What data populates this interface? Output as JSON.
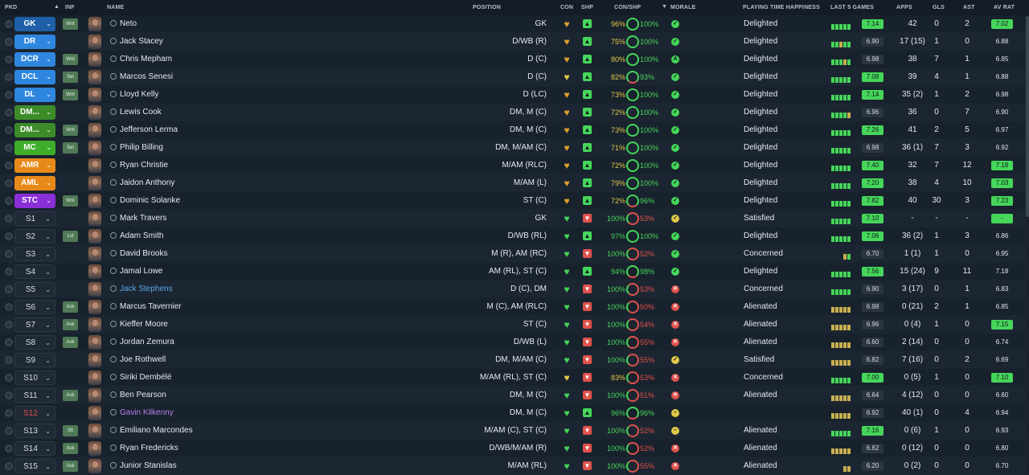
{
  "columns": {
    "pkd": "PKD",
    "inf": "INF",
    "name": "NAME",
    "position": "POSITION",
    "con": "CON",
    "shp": "SHP",
    "con_shp": "CON/SHP",
    "morale": "MORALE",
    "ptime": "PLAYING TIME HAPPINESS",
    "last5": "LAST 5 GAMES",
    "apps": "APPS",
    "gls": "GLS",
    "ast": "AST",
    "avrat": "AV RAT"
  },
  "colors": {
    "gk": "#1f5fa8",
    "def": "#2e86de",
    "dm": "#3d8c2a",
    "mid": "#3fae2b",
    "att_mid": "#e88a1a",
    "striker": "#8a2fd8",
    "good": "#45d65a",
    "bad": "#e0524c",
    "warn": "#e0c94a",
    "gold": "#e0a02a"
  },
  "players": [
    {
      "pkd": "GK",
      "pkd_color": "gk",
      "inf": "Wnt",
      "name": "Neto",
      "name_style": "",
      "position": "GK",
      "con_icon": "heart-gold-icon",
      "con_color": "gold",
      "shp": "up",
      "con_pct": "96%",
      "con_pct_color": "warn",
      "ring": "full",
      "shp_pct": "100%",
      "shp_pct_color": "good",
      "morale": "check",
      "morale_color": "good",
      "ptime": "Delighted",
      "form": [
        "good",
        "good",
        "good",
        "good",
        "good"
      ],
      "last5": "7.14",
      "last5_hi": true,
      "apps": "42",
      "gls": "0",
      "ast": "2",
      "avrat": "7.02",
      "avrat_hi": true
    },
    {
      "pkd": "DR",
      "pkd_color": "def",
      "inf": "",
      "name": "Jack Stacey",
      "name_style": "",
      "position": "D/WB (R)",
      "con_icon": "heart-gold-icon",
      "con_color": "gold",
      "shp": "up",
      "con_pct": "75%",
      "con_pct_color": "warn",
      "ring": "full",
      "shp_pct": "100%",
      "shp_pct_color": "good",
      "morale": "check",
      "morale_color": "good",
      "ptime": "Delighted",
      "form": [
        "good",
        "good",
        "warn",
        "good",
        "good"
      ],
      "last5": "6.90",
      "last5_hi": false,
      "apps": "17 (15)",
      "gls": "1",
      "ast": "0",
      "avrat": "6.88",
      "avrat_hi": false
    },
    {
      "pkd": "DCR",
      "pkd_color": "def",
      "inf": "Wnt",
      "name": "Chris Mepham",
      "name_style": "",
      "position": "D (C)",
      "con_icon": "heart-gold-icon",
      "con_color": "gold",
      "shp": "up",
      "con_pct": "80%",
      "con_pct_color": "warn",
      "ring": "full",
      "shp_pct": "100%",
      "shp_pct_color": "good",
      "morale": "A",
      "morale_color": "good",
      "ptime": "Delighted",
      "form": [
        "good",
        "good",
        "good",
        "warn",
        "good"
      ],
      "last5": "6.98",
      "last5_hi": false,
      "apps": "38",
      "gls": "7",
      "ast": "1",
      "avrat": "6.85",
      "avrat_hi": false
    },
    {
      "pkd": "DCL",
      "pkd_color": "def",
      "inf": "Sel",
      "name": "Marcos Senesi",
      "name_style": "",
      "position": "D (C)",
      "con_icon": "heart-gold-icon",
      "con_color": "warn",
      "shp": "upup",
      "con_pct": "82%",
      "con_pct_color": "warn",
      "ring": "partial",
      "shp_pct": "93%",
      "shp_pct_color": "good",
      "morale": "check",
      "morale_color": "good",
      "ptime": "Delighted",
      "form": [
        "good",
        "good",
        "good",
        "good",
        "good"
      ],
      "last5": "7.08",
      "last5_hi": true,
      "apps": "39",
      "gls": "4",
      "ast": "1",
      "avrat": "6.88",
      "avrat_hi": false
    },
    {
      "pkd": "DL",
      "pkd_color": "def",
      "inf": "Wnt",
      "name": "Lloyd Kelly",
      "name_style": "",
      "position": "D (LC)",
      "con_icon": "heart-gold-icon",
      "con_color": "gold",
      "shp": "up",
      "con_pct": "73%",
      "con_pct_color": "warn",
      "ring": "full",
      "shp_pct": "100%",
      "shp_pct_color": "good",
      "morale": "check",
      "morale_color": "good",
      "ptime": "Delighted",
      "form": [
        "good",
        "good",
        "good",
        "good",
        "good"
      ],
      "last5": "7.14",
      "last5_hi": true,
      "apps": "35 (2)",
      "gls": "1",
      "ast": "2",
      "avrat": "6.98",
      "avrat_hi": false
    },
    {
      "pkd": "DM...",
      "pkd_color": "dm",
      "inf": "",
      "name": "Lewis Cook",
      "name_style": "",
      "position": "DM, M (C)",
      "con_icon": "heart-gold-icon",
      "con_color": "gold",
      "shp": "up",
      "con_pct": "72%",
      "con_pct_color": "warn",
      "ring": "full",
      "shp_pct": "100%",
      "shp_pct_color": "good",
      "morale": "check",
      "morale_color": "good",
      "ptime": "Delighted",
      "form": [
        "good",
        "good",
        "good",
        "good",
        "warn"
      ],
      "last5": "6.96",
      "last5_hi": false,
      "apps": "36",
      "gls": "0",
      "ast": "7",
      "avrat": "6.90",
      "avrat_hi": false
    },
    {
      "pkd": "DM...",
      "pkd_color": "dm",
      "inf": "Wnt",
      "name": "Jefferson Lerma",
      "name_style": "",
      "position": "DM, M (C)",
      "con_icon": "heart-gold-icon",
      "con_color": "gold",
      "shp": "up",
      "con_pct": "73%",
      "con_pct_color": "warn",
      "ring": "full",
      "shp_pct": "100%",
      "shp_pct_color": "good",
      "morale": "check",
      "morale_color": "good",
      "ptime": "Delighted",
      "form": [
        "good",
        "good",
        "good",
        "good",
        "good"
      ],
      "last5": "7.26",
      "last5_hi": true,
      "apps": "41",
      "gls": "2",
      "ast": "5",
      "avrat": "6.97",
      "avrat_hi": false
    },
    {
      "pkd": "MC",
      "pkd_color": "mid",
      "inf": "Sel",
      "name": "Philip Billing",
      "name_style": "",
      "position": "DM, M/AM (C)",
      "con_icon": "heart-gold-icon",
      "con_color": "gold",
      "shp": "up",
      "con_pct": "71%",
      "con_pct_color": "warn",
      "ring": "full",
      "shp_pct": "100%",
      "shp_pct_color": "good",
      "morale": "check",
      "morale_color": "good",
      "ptime": "Delighted",
      "form": [
        "good",
        "good",
        "good",
        "good",
        "good"
      ],
      "last5": "6.98",
      "last5_hi": false,
      "apps": "36 (1)",
      "gls": "7",
      "ast": "3",
      "avrat": "6.92",
      "avrat_hi": false
    },
    {
      "pkd": "AMR",
      "pkd_color": "att_mid",
      "inf": "",
      "name": "Ryan Christie",
      "name_style": "",
      "position": "M/AM (RLC)",
      "con_icon": "heart-gold-icon",
      "con_color": "gold",
      "shp": "up",
      "con_pct": "72%",
      "con_pct_color": "warn",
      "ring": "full",
      "shp_pct": "100%",
      "shp_pct_color": "good",
      "morale": "check",
      "morale_color": "good",
      "ptime": "Delighted",
      "form": [
        "good",
        "good",
        "good",
        "good",
        "good"
      ],
      "last5": "7.40",
      "last5_hi": true,
      "apps": "32",
      "gls": "7",
      "ast": "12",
      "avrat": "7.18",
      "avrat_hi": true
    },
    {
      "pkd": "AML",
      "pkd_color": "att_mid",
      "inf": "",
      "name": "Jaidon Anthony",
      "name_style": "",
      "position": "M/AM (L)",
      "con_icon": "heart-gold-icon",
      "con_color": "gold",
      "shp": "up",
      "con_pct": "79%",
      "con_pct_color": "warn",
      "ring": "full",
      "shp_pct": "100%",
      "shp_pct_color": "good",
      "morale": "check",
      "morale_color": "good",
      "ptime": "Delighted",
      "form": [
        "good",
        "good",
        "good",
        "good",
        "good"
      ],
      "last5": "7.20",
      "last5_hi": true,
      "apps": "38",
      "gls": "4",
      "ast": "10",
      "avrat": "7.03",
      "avrat_hi": true
    },
    {
      "pkd": "STC",
      "pkd_color": "striker",
      "inf": "Wnt",
      "name": "Dominic Solanke",
      "name_style": "",
      "position": "ST (C)",
      "con_icon": "heart-gold-icon",
      "con_color": "gold",
      "shp": "up",
      "con_pct": "72%",
      "con_pct_color": "warn",
      "ring": "partial",
      "shp_pct": "96%",
      "shp_pct_color": "good",
      "morale": "check",
      "morale_color": "good",
      "ptime": "Delighted",
      "form": [
        "good",
        "good",
        "good",
        "good",
        "good"
      ],
      "last5": "7.82",
      "last5_hi": true,
      "apps": "40",
      "gls": "30",
      "ast": "3",
      "avrat": "7.23",
      "avrat_hi": true
    },
    {
      "pkd": "S1",
      "pkd_color": "",
      "inf": "",
      "name": "Mark Travers",
      "name_style": "",
      "position": "GK",
      "con_icon": "heart-icon",
      "con_color": "good",
      "shp": "down",
      "con_pct": "100%",
      "con_pct_color": "good",
      "ring": "low",
      "shp_pct": "53%",
      "shp_pct_color": "bad",
      "morale": "check",
      "morale_color": "warn",
      "ptime": "Satisfied",
      "form": [
        "good",
        "good",
        "good",
        "good",
        "good"
      ],
      "last5": "7.10",
      "last5_hi": true,
      "apps": "-",
      "gls": "-",
      "ast": "-",
      "avrat": "-",
      "avrat_hi": true
    },
    {
      "pkd": "S2",
      "pkd_color": "",
      "inf": "Lst",
      "name": "Adam Smith",
      "name_style": "",
      "position": "D/WB (RL)",
      "con_icon": "heart-icon",
      "con_color": "good",
      "shp": "up",
      "con_pct": "97%",
      "con_pct_color": "good",
      "ring": "full",
      "shp_pct": "100%",
      "shp_pct_color": "good",
      "morale": "check",
      "morale_color": "good",
      "ptime": "Delighted",
      "form": [
        "good",
        "good",
        "good",
        "good",
        "good"
      ],
      "last5": "7.06",
      "last5_hi": true,
      "apps": "36 (2)",
      "gls": "1",
      "ast": "3",
      "avrat": "6.86",
      "avrat_hi": false
    },
    {
      "pkd": "S3",
      "pkd_color": "",
      "inf": "",
      "name": "David Brooks",
      "name_style": "",
      "position": "M (R), AM (RC)",
      "con_icon": "heart-icon",
      "con_color": "good",
      "shp": "down",
      "con_pct": "100%",
      "con_pct_color": "good",
      "ring": "low",
      "shp_pct": "52%",
      "shp_pct_color": "bad",
      "morale": "check",
      "morale_color": "good",
      "ptime": "Concerned",
      "form": [
        "warn",
        "good"
      ],
      "last5": "6.70",
      "last5_hi": false,
      "apps": "1 (1)",
      "gls": "1",
      "ast": "0",
      "avrat": "6.95",
      "avrat_hi": false
    },
    {
      "pkd": "S4",
      "pkd_color": "",
      "inf": "",
      "name": "Jamal Lowe",
      "name_style": "",
      "position": "AM (RL), ST (C)",
      "con_icon": "heart-icon",
      "con_color": "good",
      "shp": "up",
      "con_pct": "94%",
      "con_pct_color": "good",
      "ring": "partial",
      "shp_pct": "98%",
      "shp_pct_color": "good",
      "morale": "check",
      "morale_color": "good",
      "ptime": "Delighted",
      "form": [
        "good",
        "good",
        "good",
        "good",
        "good"
      ],
      "last5": "7.56",
      "last5_hi": true,
      "apps": "15 (24)",
      "gls": "9",
      "ast": "11",
      "avrat": "7.18",
      "avrat_hi": false
    },
    {
      "pkd": "S5",
      "pkd_color": "",
      "inf": "",
      "name": "Jack Stephens",
      "name_style": "blue",
      "position": "D (C), DM",
      "con_icon": "heart-icon",
      "con_color": "good",
      "shp": "down",
      "con_pct": "100%",
      "con_pct_color": "good",
      "ring": "low",
      "shp_pct": "53%",
      "shp_pct_color": "bad",
      "morale": "x",
      "morale_color": "bad",
      "ptime": "Concerned",
      "form": [
        "good",
        "good",
        "good",
        "good",
        "good"
      ],
      "last5": "6.90",
      "last5_hi": false,
      "apps": "3 (17)",
      "gls": "0",
      "ast": "1",
      "avrat": "6.83",
      "avrat_hi": false
    },
    {
      "pkd": "S6",
      "pkd_color": "",
      "inf": "Ask",
      "name": "Marcus Tavernier",
      "name_style": "",
      "position": "M (C), AM (RLC)",
      "con_icon": "heart-icon",
      "con_color": "good",
      "shp": "down",
      "con_pct": "100%",
      "con_pct_color": "good",
      "ring": "low",
      "shp_pct": "50%",
      "shp_pct_color": "bad",
      "morale": "x",
      "morale_color": "bad",
      "ptime": "Alienated",
      "form": [
        "warn",
        "warn",
        "warn",
        "warn",
        "warn"
      ],
      "last5": "6.98",
      "last5_hi": false,
      "apps": "0 (21)",
      "gls": "2",
      "ast": "1",
      "avrat": "6.85",
      "avrat_hi": false
    },
    {
      "pkd": "S7",
      "pkd_color": "",
      "inf": "Ask",
      "name": "Kieffer Moore",
      "name_style": "",
      "position": "ST (C)",
      "con_icon": "heart-icon",
      "con_color": "good",
      "shp": "down",
      "con_pct": "100%",
      "con_pct_color": "good",
      "ring": "low",
      "shp_pct": "54%",
      "shp_pct_color": "bad",
      "morale": "x",
      "morale_color": "bad",
      "ptime": "Alienated",
      "form": [
        "warn",
        "warn",
        "warn",
        "warn",
        "warn"
      ],
      "last5": "6.96",
      "last5_hi": false,
      "apps": "0 (4)",
      "gls": "1",
      "ast": "0",
      "avrat": "7.15",
      "avrat_hi": true
    },
    {
      "pkd": "S8",
      "pkd_color": "",
      "inf": "Ask",
      "name": "Jordan Zemura",
      "name_style": "",
      "position": "D/WB (L)",
      "con_icon": "heart-icon",
      "con_color": "good",
      "shp": "down",
      "con_pct": "100%",
      "con_pct_color": "good",
      "ring": "low",
      "shp_pct": "55%",
      "shp_pct_color": "bad",
      "morale": "x",
      "morale_color": "bad",
      "ptime": "Alienated",
      "form": [
        "warn",
        "warn",
        "warn",
        "warn",
        "warn"
      ],
      "last5": "6.60",
      "last5_hi": false,
      "apps": "2 (14)",
      "gls": "0",
      "ast": "0",
      "avrat": "6.74",
      "avrat_hi": false
    },
    {
      "pkd": "S9",
      "pkd_color": "",
      "inf": "",
      "name": "Joe Rothwell",
      "name_style": "",
      "position": "DM, M/AM (C)",
      "con_icon": "heart-icon",
      "con_color": "good",
      "shp": "down",
      "con_pct": "100%",
      "con_pct_color": "good",
      "ring": "low",
      "shp_pct": "55%",
      "shp_pct_color": "bad",
      "morale": "check",
      "morale_color": "warn",
      "ptime": "Satisfied",
      "form": [
        "warn",
        "warn",
        "warn",
        "warn",
        "warn"
      ],
      "last5": "6.82",
      "last5_hi": false,
      "apps": "7 (16)",
      "gls": "0",
      "ast": "2",
      "avrat": "6.69",
      "avrat_hi": false
    },
    {
      "pkd": "S10",
      "pkd_color": "",
      "inf": "",
      "name": "Siriki Dembélé",
      "name_style": "",
      "position": "M/AM (RL), ST (C)",
      "con_icon": "heart-gold-icon",
      "con_color": "warn",
      "shp": "down",
      "con_pct": "83%",
      "con_pct_color": "warn",
      "ring": "low",
      "shp_pct": "53%",
      "shp_pct_color": "bad",
      "morale": "x",
      "morale_color": "bad",
      "ptime": "Concerned",
      "form": [
        "good",
        "good",
        "good",
        "good",
        "good"
      ],
      "last5": "7.00",
      "last5_hi": true,
      "apps": "0 (5)",
      "gls": "1",
      "ast": "0",
      "avrat": "7.10",
      "avrat_hi": true
    },
    {
      "pkd": "S11",
      "pkd_color": "",
      "inf": "Ask",
      "name": "Ben Pearson",
      "name_style": "",
      "position": "DM, M (C)",
      "con_icon": "heart-icon",
      "con_color": "good",
      "shp": "down",
      "con_pct": "100%",
      "con_pct_color": "good",
      "ring": "low",
      "shp_pct": "51%",
      "shp_pct_color": "bad",
      "morale": "x",
      "morale_color": "bad",
      "ptime": "Alienated",
      "form": [
        "warn",
        "warn",
        "warn",
        "warn",
        "warn"
      ],
      "last5": "6.64",
      "last5_hi": false,
      "apps": "4 (12)",
      "gls": "0",
      "ast": "0",
      "avrat": "6.60",
      "avrat_hi": false
    },
    {
      "pkd": "S12",
      "pkd_color": "red",
      "inf": "",
      "name": "Gavin Kilkenny",
      "name_style": "purple",
      "position": "DM, M (C)",
      "con_icon": "heart-icon",
      "con_color": "good",
      "shp": "up",
      "con_pct": "96%",
      "con_pct_color": "good",
      "ring": "partial",
      "shp_pct": "96%",
      "shp_pct_color": "good",
      "morale": "neutral",
      "morale_color": "warn",
      "ptime": "",
      "form": [
        "warn",
        "warn",
        "warn",
        "warn",
        "warn"
      ],
      "last5": "6.92",
      "last5_hi": false,
      "apps": "40 (1)",
      "gls": "0",
      "ast": "4",
      "avrat": "6.94",
      "avrat_hi": false
    },
    {
      "pkd": "S13",
      "pkd_color": "",
      "inf": "Slt",
      "name": "Emiliano Marcondes",
      "name_style": "",
      "position": "M/AM (C), ST (C)",
      "con_icon": "heart-icon",
      "con_color": "good",
      "shp": "down",
      "con_pct": "100%",
      "con_pct_color": "good",
      "ring": "low",
      "shp_pct": "52%",
      "shp_pct_color": "bad",
      "morale": "neutral",
      "morale_color": "warn",
      "ptime": "Alienated",
      "form": [
        "good",
        "good",
        "good",
        "good",
        "good"
      ],
      "last5": "7.16",
      "last5_hi": true,
      "apps": "0 (6)",
      "gls": "1",
      "ast": "0",
      "avrat": "6.93",
      "avrat_hi": false
    },
    {
      "pkd": "S14",
      "pkd_color": "",
      "inf": "Ask",
      "name": "Ryan Fredericks",
      "name_style": "",
      "position": "D/WB/M/AM (R)",
      "con_icon": "heart-icon",
      "con_color": "good",
      "shp": "down",
      "con_pct": "100%",
      "con_pct_color": "good",
      "ring": "low",
      "shp_pct": "52%",
      "shp_pct_color": "bad",
      "morale": "x",
      "morale_color": "bad",
      "ptime": "Alienated",
      "form": [
        "warn",
        "warn",
        "warn",
        "warn",
        "warn"
      ],
      "last5": "6.62",
      "last5_hi": false,
      "apps": "0 (12)",
      "gls": "0",
      "ast": "0",
      "avrat": "6.80",
      "avrat_hi": false
    },
    {
      "pkd": "S15",
      "pkd_color": "",
      "inf": "Ask",
      "name": "Junior Stanislas",
      "name_style": "",
      "position": "M/AM (RL)",
      "con_icon": "heart-icon",
      "con_color": "good",
      "shp": "down",
      "con_pct": "100%",
      "con_pct_color": "good",
      "ring": "low",
      "shp_pct": "55%",
      "shp_pct_color": "bad",
      "morale": "x",
      "morale_color": "bad",
      "ptime": "Alienated",
      "form": [
        "warn",
        "warn"
      ],
      "last5": "6.20",
      "last5_hi": false,
      "apps": "0 (2)",
      "gls": "0",
      "ast": "0",
      "avrat": "6.70",
      "avrat_hi": false
    }
  ]
}
